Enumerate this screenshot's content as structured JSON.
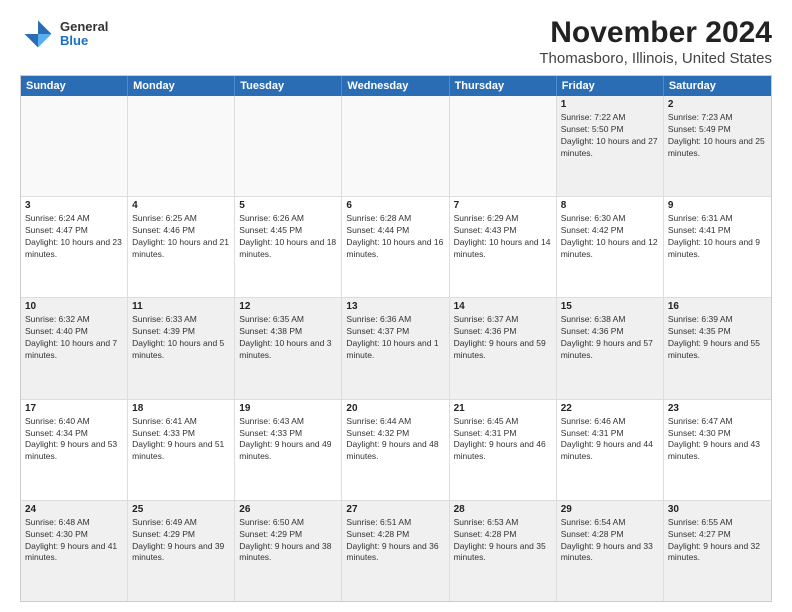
{
  "header": {
    "logo_general": "General",
    "logo_blue": "Blue",
    "title": "November 2024",
    "subtitle": "Thomasboro, Illinois, United States"
  },
  "weekdays": [
    "Sunday",
    "Monday",
    "Tuesday",
    "Wednesday",
    "Thursday",
    "Friday",
    "Saturday"
  ],
  "rows": [
    [
      {
        "day": "",
        "info": "",
        "empty": true
      },
      {
        "day": "",
        "info": "",
        "empty": true
      },
      {
        "day": "",
        "info": "",
        "empty": true
      },
      {
        "day": "",
        "info": "",
        "empty": true
      },
      {
        "day": "",
        "info": "",
        "empty": true
      },
      {
        "day": "1",
        "info": "Sunrise: 7:22 AM\nSunset: 5:50 PM\nDaylight: 10 hours and 27 minutes.",
        "empty": false
      },
      {
        "day": "2",
        "info": "Sunrise: 7:23 AM\nSunset: 5:49 PM\nDaylight: 10 hours and 25 minutes.",
        "empty": false
      }
    ],
    [
      {
        "day": "3",
        "info": "Sunrise: 6:24 AM\nSunset: 4:47 PM\nDaylight: 10 hours and 23 minutes.",
        "empty": false
      },
      {
        "day": "4",
        "info": "Sunrise: 6:25 AM\nSunset: 4:46 PM\nDaylight: 10 hours and 21 minutes.",
        "empty": false
      },
      {
        "day": "5",
        "info": "Sunrise: 6:26 AM\nSunset: 4:45 PM\nDaylight: 10 hours and 18 minutes.",
        "empty": false
      },
      {
        "day": "6",
        "info": "Sunrise: 6:28 AM\nSunset: 4:44 PM\nDaylight: 10 hours and 16 minutes.",
        "empty": false
      },
      {
        "day": "7",
        "info": "Sunrise: 6:29 AM\nSunset: 4:43 PM\nDaylight: 10 hours and 14 minutes.",
        "empty": false
      },
      {
        "day": "8",
        "info": "Sunrise: 6:30 AM\nSunset: 4:42 PM\nDaylight: 10 hours and 12 minutes.",
        "empty": false
      },
      {
        "day": "9",
        "info": "Sunrise: 6:31 AM\nSunset: 4:41 PM\nDaylight: 10 hours and 9 minutes.",
        "empty": false
      }
    ],
    [
      {
        "day": "10",
        "info": "Sunrise: 6:32 AM\nSunset: 4:40 PM\nDaylight: 10 hours and 7 minutes.",
        "empty": false
      },
      {
        "day": "11",
        "info": "Sunrise: 6:33 AM\nSunset: 4:39 PM\nDaylight: 10 hours and 5 minutes.",
        "empty": false
      },
      {
        "day": "12",
        "info": "Sunrise: 6:35 AM\nSunset: 4:38 PM\nDaylight: 10 hours and 3 minutes.",
        "empty": false
      },
      {
        "day": "13",
        "info": "Sunrise: 6:36 AM\nSunset: 4:37 PM\nDaylight: 10 hours and 1 minute.",
        "empty": false
      },
      {
        "day": "14",
        "info": "Sunrise: 6:37 AM\nSunset: 4:36 PM\nDaylight: 9 hours and 59 minutes.",
        "empty": false
      },
      {
        "day": "15",
        "info": "Sunrise: 6:38 AM\nSunset: 4:36 PM\nDaylight: 9 hours and 57 minutes.",
        "empty": false
      },
      {
        "day": "16",
        "info": "Sunrise: 6:39 AM\nSunset: 4:35 PM\nDaylight: 9 hours and 55 minutes.",
        "empty": false
      }
    ],
    [
      {
        "day": "17",
        "info": "Sunrise: 6:40 AM\nSunset: 4:34 PM\nDaylight: 9 hours and 53 minutes.",
        "empty": false
      },
      {
        "day": "18",
        "info": "Sunrise: 6:41 AM\nSunset: 4:33 PM\nDaylight: 9 hours and 51 minutes.",
        "empty": false
      },
      {
        "day": "19",
        "info": "Sunrise: 6:43 AM\nSunset: 4:33 PM\nDaylight: 9 hours and 49 minutes.",
        "empty": false
      },
      {
        "day": "20",
        "info": "Sunrise: 6:44 AM\nSunset: 4:32 PM\nDaylight: 9 hours and 48 minutes.",
        "empty": false
      },
      {
        "day": "21",
        "info": "Sunrise: 6:45 AM\nSunset: 4:31 PM\nDaylight: 9 hours and 46 minutes.",
        "empty": false
      },
      {
        "day": "22",
        "info": "Sunrise: 6:46 AM\nSunset: 4:31 PM\nDaylight: 9 hours and 44 minutes.",
        "empty": false
      },
      {
        "day": "23",
        "info": "Sunrise: 6:47 AM\nSunset: 4:30 PM\nDaylight: 9 hours and 43 minutes.",
        "empty": false
      }
    ],
    [
      {
        "day": "24",
        "info": "Sunrise: 6:48 AM\nSunset: 4:30 PM\nDaylight: 9 hours and 41 minutes.",
        "empty": false
      },
      {
        "day": "25",
        "info": "Sunrise: 6:49 AM\nSunset: 4:29 PM\nDaylight: 9 hours and 39 minutes.",
        "empty": false
      },
      {
        "day": "26",
        "info": "Sunrise: 6:50 AM\nSunset: 4:29 PM\nDaylight: 9 hours and 38 minutes.",
        "empty": false
      },
      {
        "day": "27",
        "info": "Sunrise: 6:51 AM\nSunset: 4:28 PM\nDaylight: 9 hours and 36 minutes.",
        "empty": false
      },
      {
        "day": "28",
        "info": "Sunrise: 6:53 AM\nSunset: 4:28 PM\nDaylight: 9 hours and 35 minutes.",
        "empty": false
      },
      {
        "day": "29",
        "info": "Sunrise: 6:54 AM\nSunset: 4:28 PM\nDaylight: 9 hours and 33 minutes.",
        "empty": false
      },
      {
        "day": "30",
        "info": "Sunrise: 6:55 AM\nSunset: 4:27 PM\nDaylight: 9 hours and 32 minutes.",
        "empty": false
      }
    ]
  ]
}
